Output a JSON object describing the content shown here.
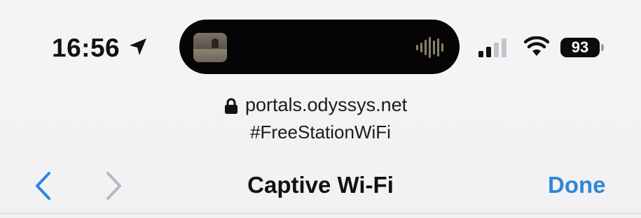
{
  "status_bar": {
    "time": "16:56",
    "battery_level": "93",
    "location_icon": "location-arrow-icon",
    "signal_icon": "cellular-signal-icon",
    "wifi_icon": "wifi-icon",
    "now_playing_icon": "audio-waveform-icon"
  },
  "address": {
    "url": "portals.odyssys.net",
    "page_title": "#FreeStationWiFi",
    "lock_icon": "lock-icon"
  },
  "nav_bar": {
    "title": "Captive Wi-Fi",
    "done_label": "Done",
    "back_icon": "chevron-left-icon",
    "forward_icon": "chevron-right-icon"
  },
  "colors": {
    "accent": "#2f86d8",
    "background": "#f2f2f4",
    "disabled": "#b8b8bd"
  }
}
